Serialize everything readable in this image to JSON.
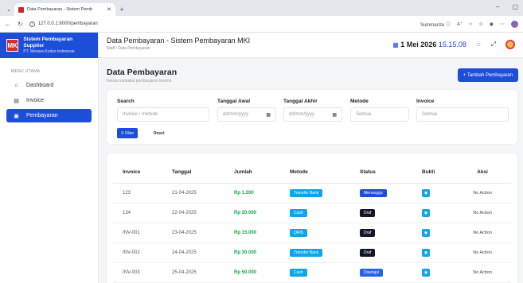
{
  "browser": {
    "tab_title": "Data Pembayaran - Sistem Pemb",
    "url": "127.0.0.1:8000/pembayaran",
    "summarize_label": "Summarize"
  },
  "brand": {
    "title": "Sistem Pembayaran Supplier",
    "subtitle": "PT. Menara Kudus Indonesia",
    "logo_text": "MK"
  },
  "sidebar": {
    "menu_label": "MENU UTAMA",
    "items": [
      {
        "label": "Dashboard",
        "icon": "home-icon"
      },
      {
        "label": "Invoice",
        "icon": "document-icon"
      },
      {
        "label": "Pembayaran",
        "icon": "payment-icon",
        "active": true
      }
    ]
  },
  "topbar": {
    "title": "Data Pembayaran - Sistem Pembayaran MKI",
    "breadcrumb": "Staff / Data Pembayaran",
    "date": "1 Mei 2026",
    "time": "15.15.08"
  },
  "page": {
    "title": "Data Pembayaran",
    "subtitle": "Kelola transaksi pembayaran invoice",
    "add_button": "+ Tambah Pembayaran"
  },
  "filters": {
    "search_label": "Search",
    "search_placeholder": "Invoice / metode",
    "tgl_awal_label": "Tanggal Awal",
    "tgl_awal_placeholder": "dd/mm/yyyy",
    "tgl_akhir_label": "Tanggal Akhir",
    "tgl_akhir_placeholder": "dd/mm/yyyy",
    "metode_label": "Metode",
    "metode_value": "Semua",
    "invoice_label": "Invoice",
    "invoice_value": "Semua",
    "filter_button": "Filter",
    "reset_button": "Reset"
  },
  "table": {
    "headers": [
      "Invoice",
      "Tanggal",
      "Jumlah",
      "Metode",
      "Status",
      "Bukti",
      "Aksi"
    ],
    "rows": [
      {
        "invoice": "123",
        "tanggal": "21-04-2025",
        "jumlah": "Rp 1.200",
        "metode": "Transfer Bank",
        "status": "Menunggu",
        "aksi": "No Action"
      },
      {
        "invoice": "134",
        "tanggal": "22-04-2025",
        "jumlah": "Rp 20.000",
        "metode": "Cash",
        "status": "Draf",
        "aksi": "No Action"
      },
      {
        "invoice": "INV-001",
        "tanggal": "23-04-2025",
        "jumlah": "Rp 15.000",
        "metode": "QRIS",
        "status": "Draf",
        "aksi": "No Action"
      },
      {
        "invoice": "INV-002",
        "tanggal": "24-04-2025",
        "jumlah": "Rp 30.000",
        "metode": "Transfer Bank",
        "status": "Draf",
        "aksi": "No Action"
      },
      {
        "invoice": "INV-003",
        "tanggal": "25-04-2025",
        "jumlah": "Rp 50.000",
        "metode": "Cash",
        "status": "Disetujui",
        "aksi": "No Action"
      }
    ]
  },
  "colors": {
    "primary": "#1d4ed8",
    "amount": "#16a34a",
    "method_badge": "#0ea5e9",
    "draft_badge": "#111827"
  }
}
